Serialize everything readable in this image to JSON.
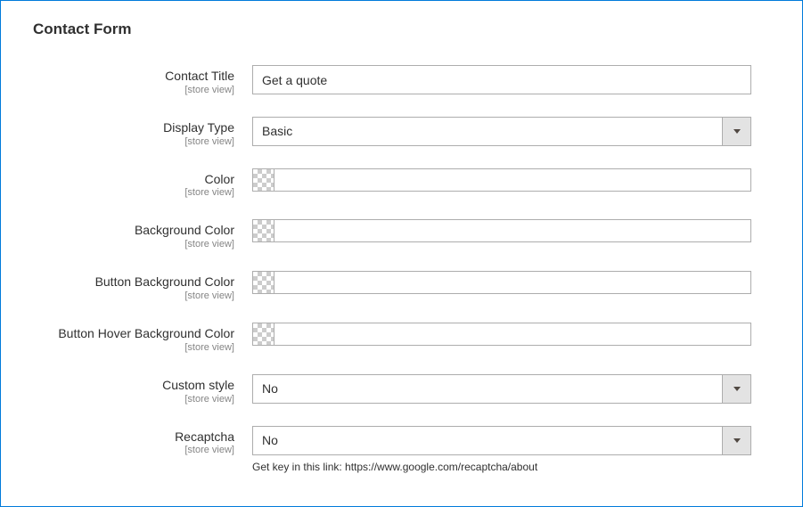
{
  "section_title": "Contact Form",
  "scope_text": "[store view]",
  "fields": {
    "contact_title": {
      "label": "Contact Title",
      "value": "Get a quote"
    },
    "display_type": {
      "label": "Display Type",
      "value": "Basic"
    },
    "color": {
      "label": "Color",
      "value": ""
    },
    "background_color": {
      "label": "Background Color",
      "value": ""
    },
    "button_background_color": {
      "label": "Button Background Color",
      "value": ""
    },
    "button_hover_background_color": {
      "label": "Button Hover Background Color",
      "value": ""
    },
    "custom_style": {
      "label": "Custom style",
      "value": "No"
    },
    "recaptcha": {
      "label": "Recaptcha",
      "value": "No",
      "help": "Get key in this link: https://www.google.com/recaptcha/about"
    }
  }
}
